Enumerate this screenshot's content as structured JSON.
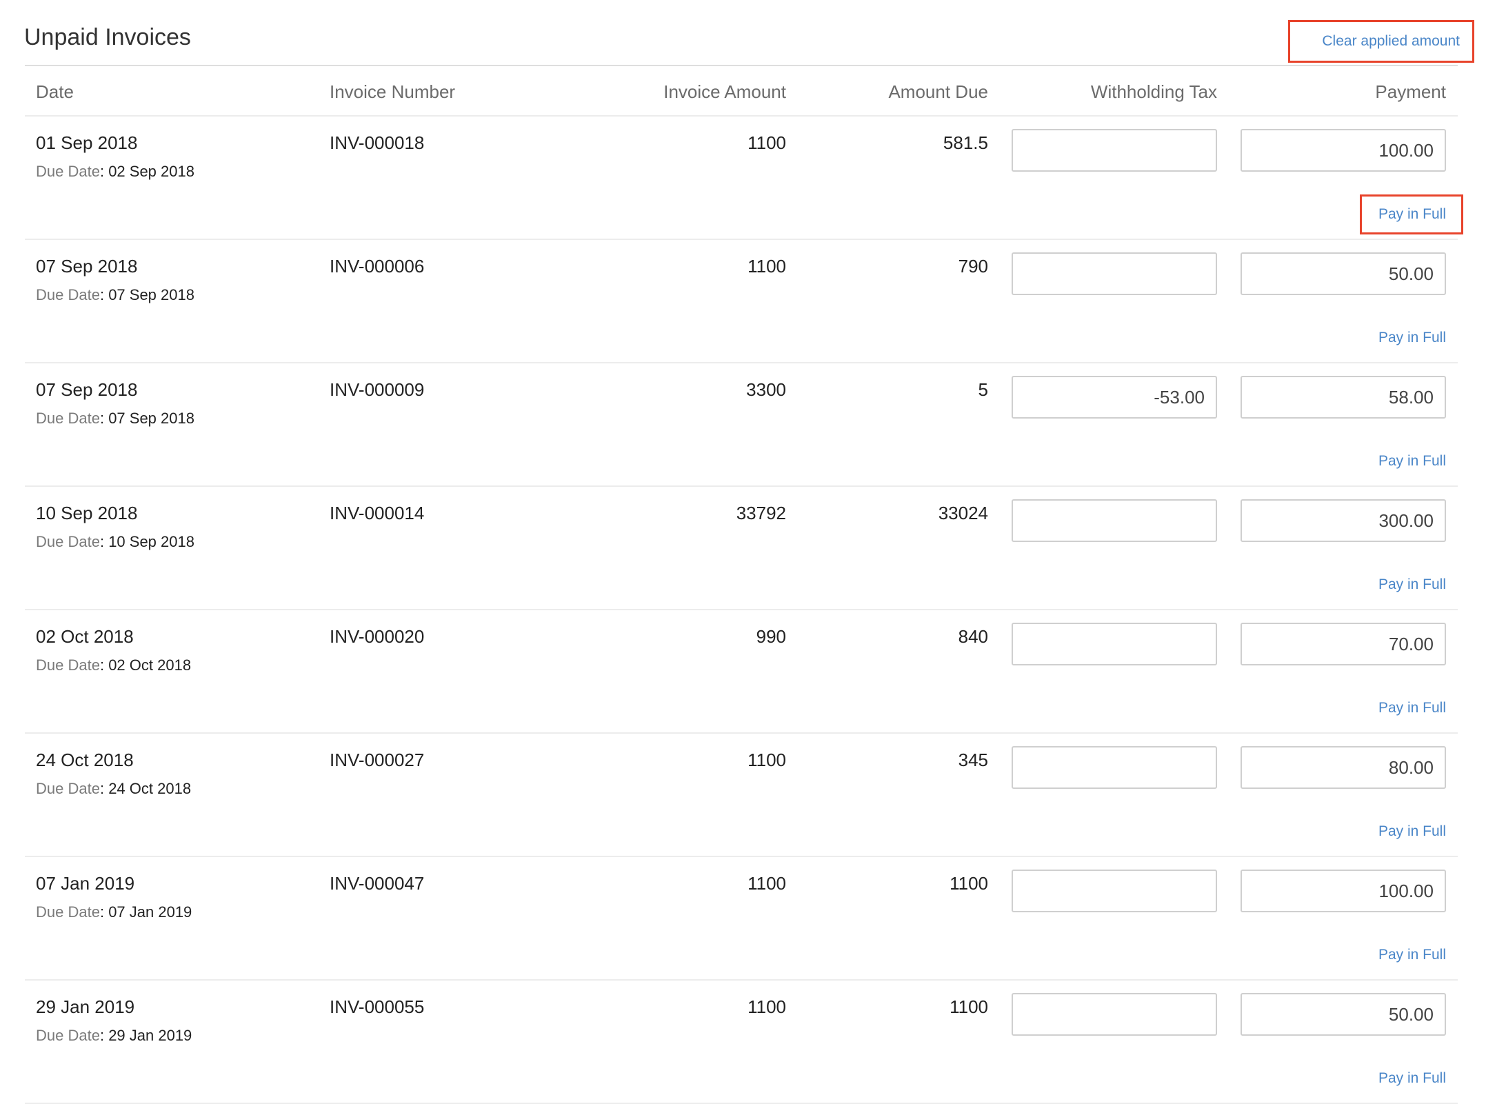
{
  "section": {
    "title": "Unpaid Invoices",
    "clear_applied_label": "Clear applied amount"
  },
  "highlight_color": "#e8432b",
  "link_color": "#4a86c8",
  "columns": {
    "date": "Date",
    "invoice_number": "Invoice Number",
    "invoice_amount": "Invoice Amount",
    "amount_due": "Amount Due",
    "withholding_tax": "Withholding Tax",
    "payment": "Payment"
  },
  "due_date_label": "Due Date",
  "pay_in_full_label": "Pay in Full",
  "rows": [
    {
      "date": "01 Sep 2018",
      "due_date": "02 Sep 2018",
      "invoice_number": "INV-000018",
      "invoice_amount": "1100",
      "amount_due": "581.5",
      "withholding_tax": "",
      "payment": "100.00"
    },
    {
      "date": "07 Sep 2018",
      "due_date": "07 Sep 2018",
      "invoice_number": "INV-000006",
      "invoice_amount": "1100",
      "amount_due": "790",
      "withholding_tax": "",
      "payment": "50.00"
    },
    {
      "date": "07 Sep 2018",
      "due_date": "07 Sep 2018",
      "invoice_number": "INV-000009",
      "invoice_amount": "3300",
      "amount_due": "5",
      "withholding_tax": "-53.00",
      "payment": "58.00"
    },
    {
      "date": "10 Sep 2018",
      "due_date": "10 Sep 2018",
      "invoice_number": "INV-000014",
      "invoice_amount": "33792",
      "amount_due": "33024",
      "withholding_tax": "",
      "payment": "300.00"
    },
    {
      "date": "02 Oct 2018",
      "due_date": "02 Oct 2018",
      "invoice_number": "INV-000020",
      "invoice_amount": "990",
      "amount_due": "840",
      "withholding_tax": "",
      "payment": "70.00"
    },
    {
      "date": "24 Oct 2018",
      "due_date": "24 Oct 2018",
      "invoice_number": "INV-000027",
      "invoice_amount": "1100",
      "amount_due": "345",
      "withholding_tax": "",
      "payment": "80.00"
    },
    {
      "date": "07 Jan 2019",
      "due_date": "07 Jan 2019",
      "invoice_number": "INV-000047",
      "invoice_amount": "1100",
      "amount_due": "1100",
      "withholding_tax": "",
      "payment": "100.00"
    },
    {
      "date": "29 Jan 2019",
      "due_date": "29 Jan 2019",
      "invoice_number": "INV-000055",
      "invoice_amount": "1100",
      "amount_due": "1100",
      "withholding_tax": "",
      "payment": "50.00"
    }
  ]
}
